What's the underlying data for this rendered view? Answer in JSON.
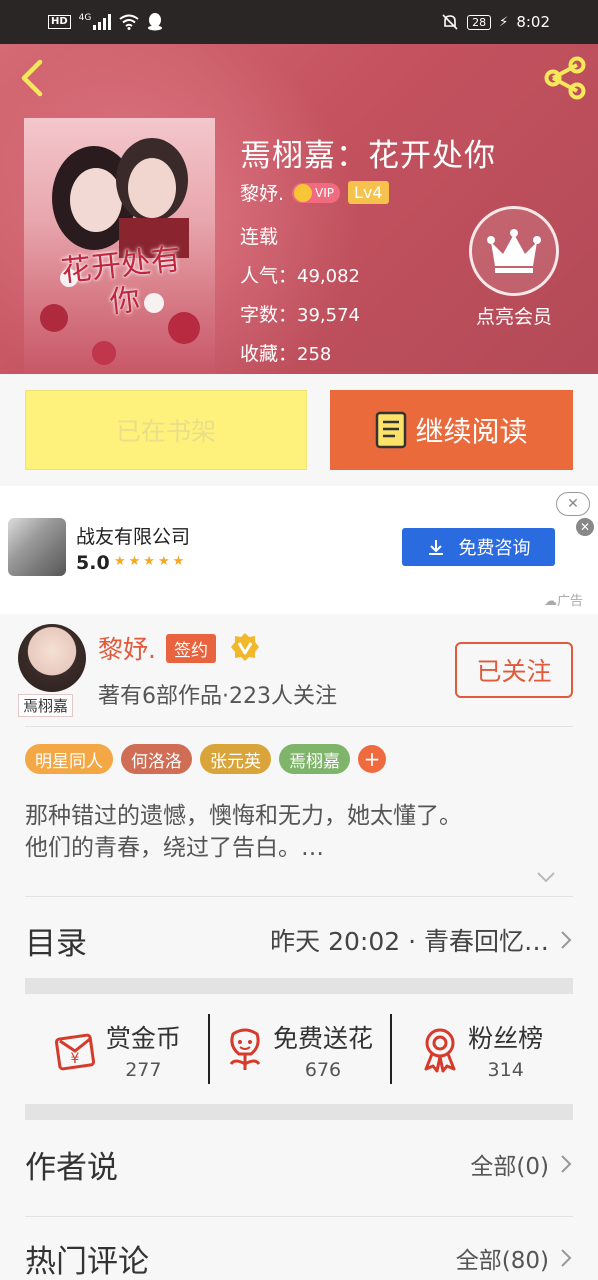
{
  "status_bar": {
    "network": "4G",
    "hd": "HD",
    "battery": "28",
    "time": "8:02"
  },
  "book": {
    "title": "焉栩嘉：花开处你",
    "author": "黎妤.",
    "vip_label": "VIP",
    "level": "Lv4",
    "status": "连载",
    "popularity_label": "人气：",
    "popularity": "49,082",
    "words_label": "字数：",
    "words": "39,574",
    "favorites_label": "收藏：",
    "favorites": "258",
    "cover_title": "花开处有你"
  },
  "vip_member": {
    "label": "点亮会员"
  },
  "buttons": {
    "shelf": "已在书架",
    "read": "继续阅读"
  },
  "ad": {
    "company": "战友有限公司",
    "rating": "5.0",
    "stars": "★★★★★",
    "cta": "免费咨询",
    "close": "✕",
    "close_small": "✕",
    "tag": "广告"
  },
  "author": {
    "name": "黎妤.",
    "sign_badge": "签约",
    "avatar_tag": "焉栩嘉",
    "stats": "著有6部作品·223人关注",
    "follow": "已关注"
  },
  "tags": [
    {
      "label": "明星同人",
      "color": "#f3a845"
    },
    {
      "label": "何洛洛",
      "color": "#cf6d55"
    },
    {
      "label": "张元英",
      "color": "#d9a43a"
    },
    {
      "label": "焉栩嘉",
      "color": "#7eb56a"
    }
  ],
  "tag_plus": "+",
  "synopsis": {
    "line1": "那种错过的遗憾，懊悔和无力，她太懂了。",
    "line2": "他们的青春，绕过了告白。…"
  },
  "catalog": {
    "title": "目录",
    "latest": "昨天 20:02 · 青春回忆…"
  },
  "actions": [
    {
      "label": "赏金币",
      "count": "277"
    },
    {
      "label": "免费送花",
      "count": "676"
    },
    {
      "label": "粉丝榜",
      "count": "314"
    }
  ],
  "author_says": {
    "title": "作者说",
    "right": "全部(0)"
  },
  "hot_comments": {
    "title": "热门评论",
    "right": "全部(80)"
  },
  "colors": {
    "accent": "#e05a3b",
    "read_button": "#ea6a3c",
    "shelf_button": "#fef27c",
    "header": "#c4525f",
    "ad_button": "#2a6be0"
  }
}
